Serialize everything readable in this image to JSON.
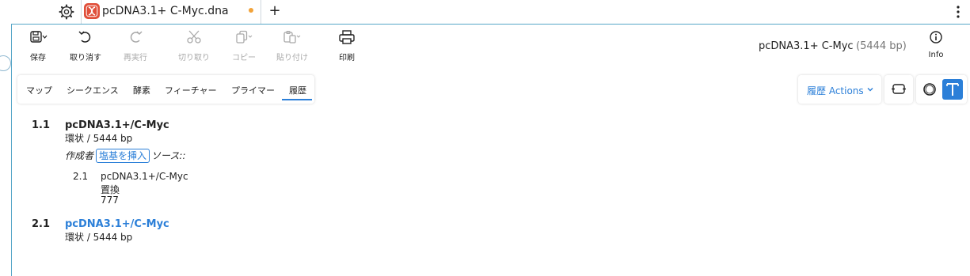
{
  "tabbar": {
    "document_title": "pcDNA3.1+ C-Myc.dna",
    "settings_icon": "gear-icon",
    "new_tab_label": "+",
    "more_icon": "vertical-ellipsis-icon",
    "unsaved_indicator_color": "#f2a33a"
  },
  "toolbar": {
    "items": [
      {
        "label": "保存",
        "icon": "save-icon",
        "enabled": true
      },
      {
        "label": "取り消す",
        "icon": "undo-icon",
        "enabled": true
      },
      {
        "label": "再実行",
        "icon": "redo-icon",
        "enabled": false
      },
      {
        "label": "切り取り",
        "icon": "scissors-icon",
        "enabled": false
      },
      {
        "label": "コピー",
        "icon": "copy-icon",
        "enabled": false
      },
      {
        "label": "貼り付け",
        "icon": "paste-icon",
        "enabled": false
      },
      {
        "label": "印刷",
        "icon": "printer-icon",
        "enabled": true
      }
    ],
    "info_label": "Info"
  },
  "sequence": {
    "name": "pcDNA3.1+ C-Myc",
    "length": "(5444 bp)"
  },
  "view_tabs": {
    "items": [
      "マップ",
      "シークエンス",
      "酵素",
      "フィーチャー",
      "プライマー",
      "履歴"
    ],
    "active": "履歴"
  },
  "actions": {
    "label": "履歴 Actions"
  },
  "history": {
    "entries": [
      {
        "number": "1.1",
        "title": "pcDNA3.1+/C-Myc",
        "topology": "環状 / 5444 bp",
        "author_label": "作成者",
        "action_chip": "塩基を挿入",
        "source_label": "ソース::",
        "children": [
          {
            "number": "2.1",
            "title": "pcDNA3.1+/C-Myc",
            "operation": "置換",
            "value": "777"
          }
        ]
      },
      {
        "number": "2.1",
        "title": "pcDNA3.1+/C-Myc",
        "topology": "環状 / 5444 bp"
      }
    ]
  },
  "colors": {
    "accent": "#2b7fd8",
    "app_icon": "#e0503b",
    "frame_border": "#56a6c8"
  }
}
